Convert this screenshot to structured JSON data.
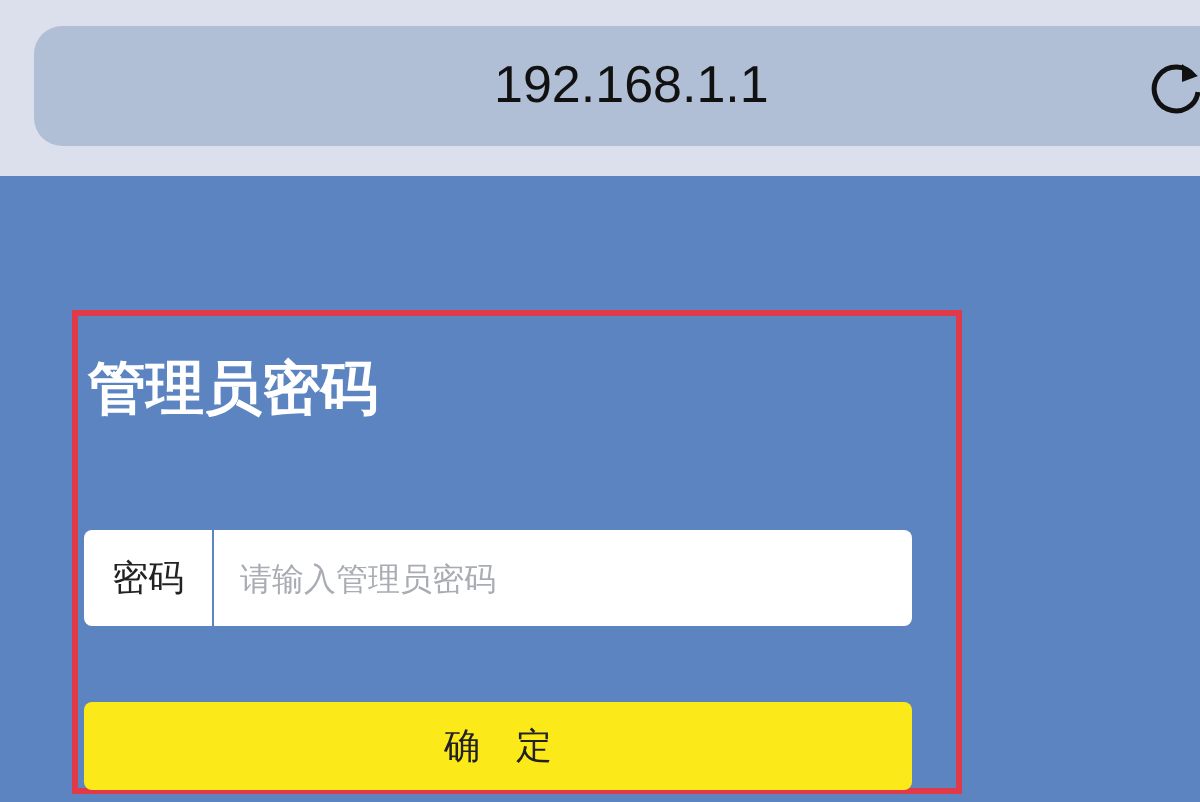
{
  "address_bar": {
    "url": "192.168.1.1"
  },
  "login": {
    "title": "管理员密码",
    "field": {
      "label": "密码",
      "placeholder": "请输入管理员密码"
    },
    "button": "确　定"
  }
}
